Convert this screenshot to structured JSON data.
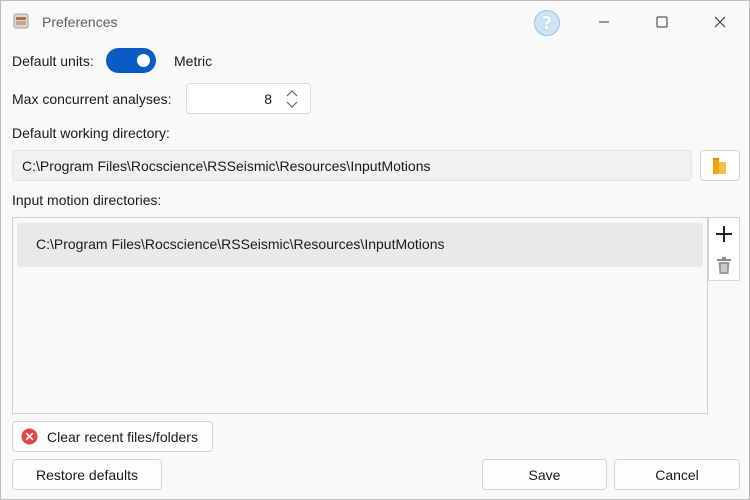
{
  "window": {
    "title": "Preferences",
    "help_label": "?"
  },
  "settings": {
    "units_label": "Default units:",
    "units_value": "Metric",
    "units_toggle_on": true,
    "max_analyses_label": "Max concurrent analyses:",
    "max_analyses_value": "8",
    "working_dir_label": "Default working directory:",
    "working_dir_value": "C:\\Program Files\\Rocscience\\RSSeismic\\Resources\\InputMotions",
    "input_dirs_label": "Input motion directories:",
    "input_dirs": [
      "C:\\Program Files\\Rocscience\\RSSeismic\\Resources\\InputMotions"
    ]
  },
  "buttons": {
    "clear_recent": "Clear recent files/folders",
    "restore_defaults": "Restore defaults",
    "save": "Save",
    "cancel": "Cancel"
  },
  "icons": {
    "app": "app-icon",
    "help": "help-icon",
    "folder": "folder-icon",
    "add": "plus-icon",
    "delete": "trash-icon",
    "clear": "close-circle-icon"
  },
  "colors": {
    "accent": "#0a5cc2",
    "clear_icon": "#e0474c",
    "folder_icon": "#f0a30a"
  }
}
